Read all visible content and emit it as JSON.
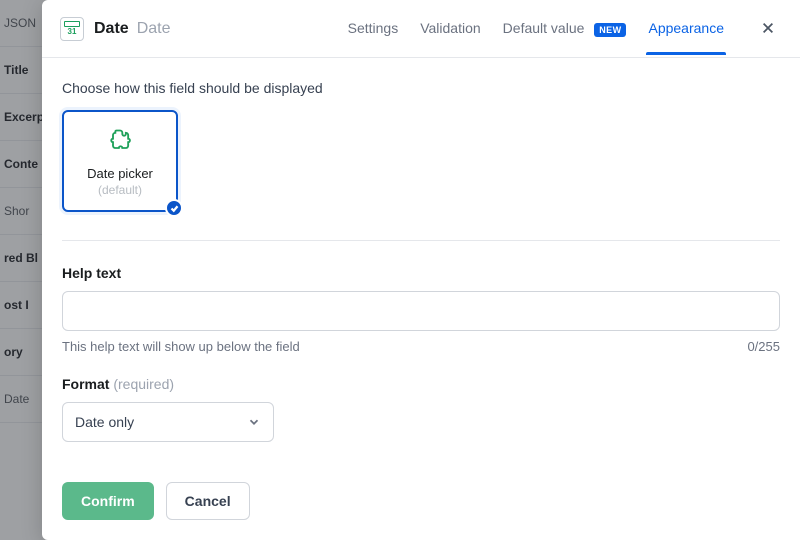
{
  "background_items": [
    "JSON",
    "Title",
    "Excerp",
    "Conte",
    "Shor",
    "red Bl",
    "ost I",
    "ory",
    "Date"
  ],
  "header": {
    "field_name": "Date",
    "field_type": "Date",
    "icon_day": "31"
  },
  "tabs": {
    "settings": "Settings",
    "validation": "Validation",
    "default_value": "Default value",
    "new_badge": "NEW",
    "appearance": "Appearance"
  },
  "body": {
    "display_label": "Choose how this field should be displayed",
    "card_title": "Date picker",
    "card_subtitle": "(default)",
    "help_label": "Help text",
    "help_value": "",
    "help_hint": "This help text will show up below the field",
    "help_counter": "0/255",
    "format_label": "Format",
    "format_required": " (required)",
    "format_value": "Date only"
  },
  "footer": {
    "confirm": "Confirm",
    "cancel": "Cancel"
  }
}
